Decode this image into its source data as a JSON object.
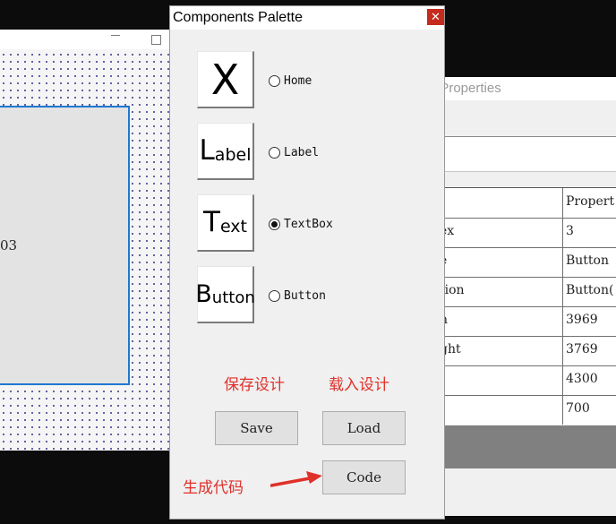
{
  "designer": {
    "panel_text": "03"
  },
  "properties": {
    "title_fragment": "t Properties",
    "header_right": "Propert",
    "rows": [
      {
        "key": "ex",
        "value": "3"
      },
      {
        "key": "e",
        "value": "Button"
      },
      {
        "key": "tion",
        "value": "Button("
      },
      {
        "key": "h",
        "value": "3969"
      },
      {
        "key": "ght",
        "value": "3769"
      },
      {
        "key": "",
        "value": "4300"
      },
      {
        "key": "",
        "value": "700"
      }
    ]
  },
  "palette": {
    "title": "Components Palette",
    "close_glyph": "✕",
    "tools": [
      {
        "big": "X",
        "small": "",
        "radio_label": "Home",
        "checked": false
      },
      {
        "big": "L",
        "small": "abel",
        "radio_label": "Label",
        "checked": false
      },
      {
        "big": "T",
        "small": "ext",
        "radio_label": "TextBox",
        "checked": true
      },
      {
        "big": "B",
        "small": "utton",
        "radio_label": "Button",
        "checked": false
      }
    ],
    "annotations": {
      "save_design": "保存设计",
      "load_design": "载入设计",
      "generate_code": "生成代码"
    },
    "buttons": {
      "save": "Save",
      "load": "Load",
      "code": "Code"
    }
  },
  "colors": {
    "annotation": "#e0302a",
    "selection_border": "#1e78d0",
    "close_button": "#c42b1c"
  }
}
